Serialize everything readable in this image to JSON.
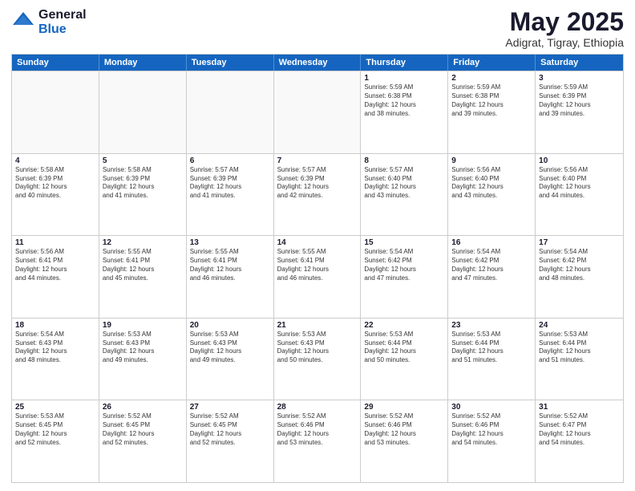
{
  "header": {
    "logo_general": "General",
    "logo_blue": "Blue",
    "month_title": "May 2025",
    "location": "Adigrat, Tigray, Ethiopia"
  },
  "weekdays": [
    "Sunday",
    "Monday",
    "Tuesday",
    "Wednesday",
    "Thursday",
    "Friday",
    "Saturday"
  ],
  "rows": [
    [
      {
        "day": "",
        "info": "",
        "empty": true
      },
      {
        "day": "",
        "info": "",
        "empty": true
      },
      {
        "day": "",
        "info": "",
        "empty": true
      },
      {
        "day": "",
        "info": "",
        "empty": true
      },
      {
        "day": "1",
        "info": "Sunrise: 5:59 AM\nSunset: 6:38 PM\nDaylight: 12 hours\nand 38 minutes.",
        "empty": false
      },
      {
        "day": "2",
        "info": "Sunrise: 5:59 AM\nSunset: 6:38 PM\nDaylight: 12 hours\nand 39 minutes.",
        "empty": false
      },
      {
        "day": "3",
        "info": "Sunrise: 5:59 AM\nSunset: 6:39 PM\nDaylight: 12 hours\nand 39 minutes.",
        "empty": false
      }
    ],
    [
      {
        "day": "4",
        "info": "Sunrise: 5:58 AM\nSunset: 6:39 PM\nDaylight: 12 hours\nand 40 minutes.",
        "empty": false
      },
      {
        "day": "5",
        "info": "Sunrise: 5:58 AM\nSunset: 6:39 PM\nDaylight: 12 hours\nand 41 minutes.",
        "empty": false
      },
      {
        "day": "6",
        "info": "Sunrise: 5:57 AM\nSunset: 6:39 PM\nDaylight: 12 hours\nand 41 minutes.",
        "empty": false
      },
      {
        "day": "7",
        "info": "Sunrise: 5:57 AM\nSunset: 6:39 PM\nDaylight: 12 hours\nand 42 minutes.",
        "empty": false
      },
      {
        "day": "8",
        "info": "Sunrise: 5:57 AM\nSunset: 6:40 PM\nDaylight: 12 hours\nand 43 minutes.",
        "empty": false
      },
      {
        "day": "9",
        "info": "Sunrise: 5:56 AM\nSunset: 6:40 PM\nDaylight: 12 hours\nand 43 minutes.",
        "empty": false
      },
      {
        "day": "10",
        "info": "Sunrise: 5:56 AM\nSunset: 6:40 PM\nDaylight: 12 hours\nand 44 minutes.",
        "empty": false
      }
    ],
    [
      {
        "day": "11",
        "info": "Sunrise: 5:56 AM\nSunset: 6:41 PM\nDaylight: 12 hours\nand 44 minutes.",
        "empty": false
      },
      {
        "day": "12",
        "info": "Sunrise: 5:55 AM\nSunset: 6:41 PM\nDaylight: 12 hours\nand 45 minutes.",
        "empty": false
      },
      {
        "day": "13",
        "info": "Sunrise: 5:55 AM\nSunset: 6:41 PM\nDaylight: 12 hours\nand 46 minutes.",
        "empty": false
      },
      {
        "day": "14",
        "info": "Sunrise: 5:55 AM\nSunset: 6:41 PM\nDaylight: 12 hours\nand 46 minutes.",
        "empty": false
      },
      {
        "day": "15",
        "info": "Sunrise: 5:54 AM\nSunset: 6:42 PM\nDaylight: 12 hours\nand 47 minutes.",
        "empty": false
      },
      {
        "day": "16",
        "info": "Sunrise: 5:54 AM\nSunset: 6:42 PM\nDaylight: 12 hours\nand 47 minutes.",
        "empty": false
      },
      {
        "day": "17",
        "info": "Sunrise: 5:54 AM\nSunset: 6:42 PM\nDaylight: 12 hours\nand 48 minutes.",
        "empty": false
      }
    ],
    [
      {
        "day": "18",
        "info": "Sunrise: 5:54 AM\nSunset: 6:43 PM\nDaylight: 12 hours\nand 48 minutes.",
        "empty": false
      },
      {
        "day": "19",
        "info": "Sunrise: 5:53 AM\nSunset: 6:43 PM\nDaylight: 12 hours\nand 49 minutes.",
        "empty": false
      },
      {
        "day": "20",
        "info": "Sunrise: 5:53 AM\nSunset: 6:43 PM\nDaylight: 12 hours\nand 49 minutes.",
        "empty": false
      },
      {
        "day": "21",
        "info": "Sunrise: 5:53 AM\nSunset: 6:43 PM\nDaylight: 12 hours\nand 50 minutes.",
        "empty": false
      },
      {
        "day": "22",
        "info": "Sunrise: 5:53 AM\nSunset: 6:44 PM\nDaylight: 12 hours\nand 50 minutes.",
        "empty": false
      },
      {
        "day": "23",
        "info": "Sunrise: 5:53 AM\nSunset: 6:44 PM\nDaylight: 12 hours\nand 51 minutes.",
        "empty": false
      },
      {
        "day": "24",
        "info": "Sunrise: 5:53 AM\nSunset: 6:44 PM\nDaylight: 12 hours\nand 51 minutes.",
        "empty": false
      }
    ],
    [
      {
        "day": "25",
        "info": "Sunrise: 5:53 AM\nSunset: 6:45 PM\nDaylight: 12 hours\nand 52 minutes.",
        "empty": false
      },
      {
        "day": "26",
        "info": "Sunrise: 5:52 AM\nSunset: 6:45 PM\nDaylight: 12 hours\nand 52 minutes.",
        "empty": false
      },
      {
        "day": "27",
        "info": "Sunrise: 5:52 AM\nSunset: 6:45 PM\nDaylight: 12 hours\nand 52 minutes.",
        "empty": false
      },
      {
        "day": "28",
        "info": "Sunrise: 5:52 AM\nSunset: 6:46 PM\nDaylight: 12 hours\nand 53 minutes.",
        "empty": false
      },
      {
        "day": "29",
        "info": "Sunrise: 5:52 AM\nSunset: 6:46 PM\nDaylight: 12 hours\nand 53 minutes.",
        "empty": false
      },
      {
        "day": "30",
        "info": "Sunrise: 5:52 AM\nSunset: 6:46 PM\nDaylight: 12 hours\nand 54 minutes.",
        "empty": false
      },
      {
        "day": "31",
        "info": "Sunrise: 5:52 AM\nSunset: 6:47 PM\nDaylight: 12 hours\nand 54 minutes.",
        "empty": false
      }
    ]
  ]
}
